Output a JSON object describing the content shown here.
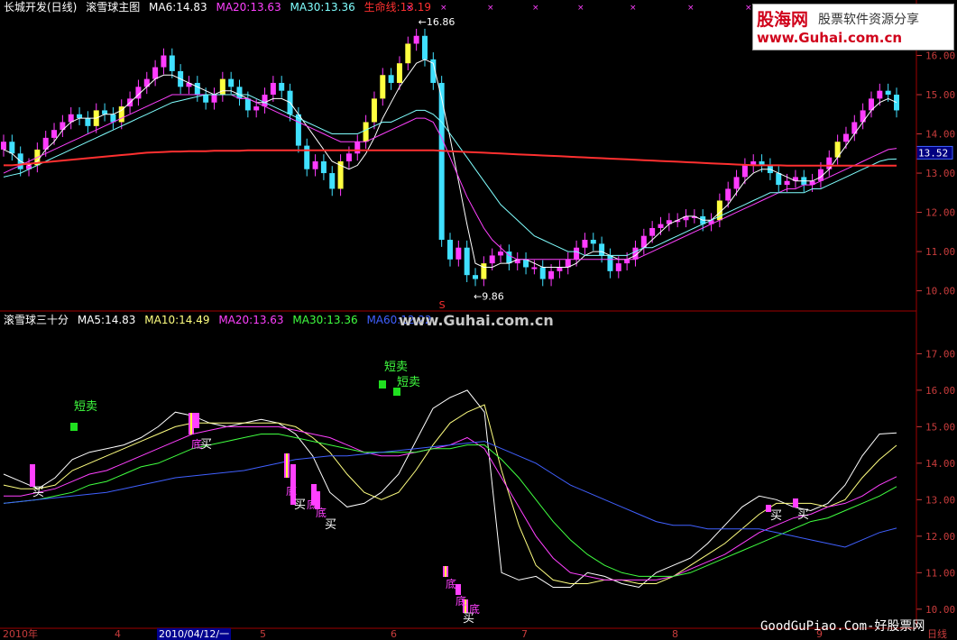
{
  "top_panel": {
    "labels": [
      {
        "text": "长城开发(日线)",
        "color": "#ffffff"
      },
      {
        "text": "滚雪球主图",
        "color": "#ffffff"
      },
      {
        "text": "MA6:14.83",
        "color": "#ffffff"
      },
      {
        "text": "MA20:13.63",
        "color": "#ff40ff"
      },
      {
        "text": "MA30:13.36",
        "color": "#80ffff"
      },
      {
        "text": "生命线:13.19",
        "color": "#ff3030"
      }
    ],
    "high_label": "16.86",
    "low_label": "9.86",
    "current_price": "13.52",
    "marker_s": "S"
  },
  "bottom_panel": {
    "labels": [
      {
        "text": "滚雪球三十分",
        "color": "#ffffff"
      },
      {
        "text": "MA5:14.83",
        "color": "#ffffff"
      },
      {
        "text": "MA10:14.49",
        "color": "#ffff80"
      },
      {
        "text": "MA20:13.63",
        "color": "#ff40ff"
      },
      {
        "text": "MA30:13.36",
        "color": "#40ff40"
      },
      {
        "text": "MA60:12.22",
        "color": "#4060ff"
      }
    ],
    "signals": {
      "short_sell": "短卖",
      "buy": "买",
      "bottom": "底"
    }
  },
  "logo": {
    "line1": "股海网",
    "line1b": "股票软件资源分享",
    "line2": "www.Guhai.com.cn"
  },
  "watermark": "www.Guhai.com.cn",
  "footer_mark": "GoodGuPiao.Com-好股票网",
  "x_axis": {
    "labels": [
      "2010年",
      "4",
      "2010/04/12/一",
      "5",
      "6",
      "7",
      "8",
      "9",
      "日线"
    ],
    "selected": "2010/04/12/一"
  },
  "chart_data": [
    {
      "type": "candlestick",
      "title": "长城开发(日线) 滚雪球主图",
      "ylim": [
        9.6,
        17.0
      ],
      "y_ticks": [
        10.0,
        11.0,
        12.0,
        13.0,
        14.0,
        15.0,
        16.0
      ],
      "close": [
        13.8,
        13.5,
        13.1,
        13.2,
        13.6,
        13.9,
        14.1,
        14.3,
        14.5,
        14.4,
        14.2,
        14.6,
        14.5,
        14.3,
        14.7,
        14.9,
        15.2,
        15.4,
        15.7,
        16.0,
        15.6,
        15.2,
        15.3,
        15.0,
        14.8,
        15.0,
        15.4,
        15.2,
        14.9,
        14.6,
        14.7,
        15.0,
        15.3,
        15.1,
        14.5,
        13.7,
        13.1,
        13.3,
        13.0,
        12.6,
        13.3,
        13.5,
        13.8,
        14.3,
        14.9,
        15.5,
        15.3,
        15.8,
        16.3,
        16.5,
        15.9,
        15.3,
        11.3,
        10.8,
        11.1,
        10.4,
        10.3,
        10.7,
        10.9,
        11.0,
        10.7,
        10.8,
        10.6,
        10.6,
        10.3,
        10.5,
        10.6,
        10.8,
        11.1,
        11.3,
        11.2,
        10.9,
        10.5,
        10.7,
        10.8,
        11.1,
        11.4,
        11.6,
        11.7,
        11.8,
        11.8,
        11.9,
        11.9,
        11.7,
        11.8,
        12.3,
        12.6,
        12.9,
        13.2,
        13.3,
        13.2,
        13.0,
        12.7,
        12.8,
        12.9,
        12.7,
        12.8,
        13.1,
        13.4,
        13.8,
        14.0,
        14.3,
        14.6,
        14.9,
        15.1,
        15.0,
        14.6
      ],
      "series": [
        {
          "name": "MA6",
          "values": [
            13.6,
            13.5,
            13.3,
            13.2,
            13.3,
            13.6,
            13.8,
            14.1,
            14.3,
            14.4,
            14.4,
            14.4,
            14.5,
            14.5,
            14.6,
            14.8,
            15.0,
            15.2,
            15.4,
            15.5,
            15.5,
            15.4,
            15.3,
            15.2,
            15.1,
            15.0,
            15.1,
            15.1,
            15.0,
            14.9,
            14.8,
            14.8,
            14.9,
            14.9,
            14.8,
            14.5,
            14.2,
            13.9,
            13.6,
            13.3,
            13.2,
            13.1,
            13.2,
            13.5,
            13.9,
            14.4,
            14.8,
            15.2,
            15.5,
            15.8,
            15.9,
            15.8,
            14.9,
            13.9,
            12.8,
            11.7,
            10.7,
            10.6,
            10.6,
            10.7,
            10.7,
            10.8,
            10.8,
            10.7,
            10.6,
            10.6,
            10.6,
            10.6,
            10.7,
            10.9,
            11.0,
            11.0,
            10.9,
            10.8,
            10.8,
            10.9,
            11.1,
            11.3,
            11.5,
            11.7,
            11.8,
            11.9,
            11.9,
            11.8,
            11.8,
            12.0,
            12.2,
            12.5,
            12.8,
            13.0,
            13.1,
            13.1,
            13.0,
            12.9,
            12.8,
            12.8,
            12.8,
            12.9,
            13.1,
            13.4,
            13.7,
            14.0,
            14.3,
            14.6,
            14.8,
            14.9,
            14.8
          ]
        },
        {
          "name": "MA20",
          "values": [
            13.0,
            13.1,
            13.2,
            13.3,
            13.4,
            13.5,
            13.6,
            13.7,
            13.8,
            13.9,
            14.0,
            14.1,
            14.2,
            14.3,
            14.4,
            14.5,
            14.6,
            14.7,
            14.8,
            14.9,
            15.0,
            15.0,
            15.0,
            15.0,
            15.0,
            15.0,
            15.0,
            15.0,
            14.9,
            14.9,
            14.8,
            14.7,
            14.6,
            14.5,
            14.4,
            14.3,
            14.2,
            14.1,
            14.0,
            13.9,
            13.8,
            13.8,
            13.8,
            13.8,
            13.9,
            14.0,
            14.1,
            14.2,
            14.3,
            14.4,
            14.4,
            14.3,
            13.9,
            13.4,
            12.9,
            12.4,
            12.0,
            11.6,
            11.3,
            11.1,
            10.9,
            10.8,
            10.8,
            10.8,
            10.8,
            10.8,
            10.8,
            10.8,
            10.8,
            10.8,
            10.8,
            10.8,
            10.8,
            10.8,
            10.8,
            10.8,
            10.9,
            11.0,
            11.1,
            11.2,
            11.3,
            11.4,
            11.5,
            11.6,
            11.7,
            11.8,
            11.9,
            12.0,
            12.1,
            12.2,
            12.3,
            12.4,
            12.5,
            12.6,
            12.6,
            12.7,
            12.7,
            12.8,
            12.9,
            13.0,
            13.1,
            13.2,
            13.3,
            13.4,
            13.5,
            13.6,
            13.63
          ]
        },
        {
          "name": "MA30",
          "values": [
            12.9,
            12.95,
            13.0,
            13.1,
            13.2,
            13.3,
            13.4,
            13.5,
            13.6,
            13.7,
            13.8,
            13.9,
            14.0,
            14.1,
            14.2,
            14.3,
            14.4,
            14.5,
            14.6,
            14.7,
            14.8,
            14.85,
            14.9,
            14.95,
            15.0,
            15.0,
            15.0,
            15.0,
            15.0,
            15.0,
            14.9,
            14.8,
            14.7,
            14.6,
            14.5,
            14.4,
            14.3,
            14.2,
            14.1,
            14.0,
            14.0,
            14.0,
            14.0,
            14.1,
            14.2,
            14.3,
            14.3,
            14.4,
            14.5,
            14.6,
            14.6,
            14.5,
            14.3,
            14.0,
            13.7,
            13.4,
            13.1,
            12.8,
            12.5,
            12.2,
            12.0,
            11.8,
            11.6,
            11.4,
            11.3,
            11.2,
            11.1,
            11.0,
            11.0,
            10.9,
            10.9,
            10.9,
            10.9,
            10.9,
            10.9,
            11.0,
            11.1,
            11.1,
            11.2,
            11.3,
            11.4,
            11.5,
            11.6,
            11.7,
            11.8,
            11.9,
            12.0,
            12.1,
            12.2,
            12.3,
            12.4,
            12.5,
            12.5,
            12.5,
            12.5,
            12.5,
            12.6,
            12.6,
            12.7,
            12.8,
            12.9,
            13.0,
            13.1,
            13.2,
            13.3,
            13.35,
            13.36
          ]
        },
        {
          "name": "生命线",
          "values": [
            13.2,
            13.2,
            13.22,
            13.24,
            13.26,
            13.28,
            13.3,
            13.32,
            13.34,
            13.36,
            13.38,
            13.4,
            13.42,
            13.44,
            13.46,
            13.48,
            13.5,
            13.52,
            13.53,
            13.54,
            13.55,
            13.55,
            13.56,
            13.56,
            13.56,
            13.57,
            13.57,
            13.57,
            13.57,
            13.58,
            13.58,
            13.58,
            13.58,
            13.58,
            13.58,
            13.58,
            13.58,
            13.58,
            13.58,
            13.58,
            13.58,
            13.58,
            13.58,
            13.58,
            13.58,
            13.58,
            13.58,
            13.58,
            13.58,
            13.58,
            13.58,
            13.58,
            13.57,
            13.56,
            13.55,
            13.54,
            13.53,
            13.52,
            13.51,
            13.5,
            13.49,
            13.48,
            13.47,
            13.46,
            13.45,
            13.44,
            13.43,
            13.42,
            13.41,
            13.4,
            13.39,
            13.38,
            13.37,
            13.36,
            13.35,
            13.34,
            13.33,
            13.32,
            13.31,
            13.3,
            13.29,
            13.28,
            13.27,
            13.26,
            13.25,
            13.24,
            13.23,
            13.22,
            13.21,
            13.2,
            13.2,
            13.2,
            13.2,
            13.19,
            13.19,
            13.19,
            13.19,
            13.19,
            13.19,
            13.19,
            13.19,
            13.19,
            13.19,
            13.19,
            13.19,
            13.19,
            13.19
          ]
        }
      ]
    },
    {
      "type": "line",
      "title": "滚雪球三十分",
      "ylim": [
        9.6,
        17.8
      ],
      "y_ticks": [
        10.0,
        11.0,
        12.0,
        13.0,
        14.0,
        15.0,
        16.0,
        17.0
      ],
      "series": [
        {
          "name": "MA5",
          "values": [
            13.7,
            13.5,
            13.3,
            13.6,
            14.1,
            14.3,
            14.4,
            14.5,
            14.7,
            15.0,
            15.4,
            15.3,
            15.1,
            15.0,
            15.1,
            15.2,
            15.1,
            14.8,
            14.2,
            13.2,
            12.8,
            12.9,
            13.2,
            13.7,
            14.6,
            15.5,
            15.8,
            16.0,
            15.4,
            11.0,
            10.8,
            10.9,
            10.6,
            10.6,
            11.0,
            10.9,
            10.7,
            10.6,
            11.0,
            11.2,
            11.4,
            11.8,
            12.3,
            12.8,
            13.1,
            13.0,
            12.8,
            12.7,
            12.9,
            13.4,
            14.2,
            14.8,
            14.83
          ]
        },
        {
          "name": "MA10",
          "values": [
            13.4,
            13.3,
            13.3,
            13.4,
            13.8,
            14.0,
            14.2,
            14.4,
            14.6,
            14.8,
            15.0,
            15.1,
            15.1,
            15.1,
            15.1,
            15.1,
            15.1,
            15.0,
            14.7,
            14.3,
            13.7,
            13.2,
            13.0,
            13.2,
            13.8,
            14.5,
            15.1,
            15.4,
            15.6,
            13.8,
            12.3,
            11.2,
            10.8,
            10.7,
            10.7,
            10.8,
            10.8,
            10.7,
            10.7,
            10.9,
            11.2,
            11.5,
            11.8,
            12.2,
            12.6,
            12.9,
            12.9,
            12.9,
            12.8,
            13.0,
            13.6,
            14.1,
            14.49
          ]
        },
        {
          "name": "MA20",
          "values": [
            13.1,
            13.1,
            13.2,
            13.3,
            13.5,
            13.7,
            13.8,
            14.0,
            14.2,
            14.4,
            14.6,
            14.8,
            14.9,
            15.0,
            15.0,
            15.0,
            15.0,
            14.9,
            14.8,
            14.7,
            14.5,
            14.3,
            14.2,
            14.2,
            14.3,
            14.4,
            14.5,
            14.7,
            14.4,
            13.6,
            12.8,
            12.0,
            11.4,
            11.0,
            10.9,
            10.8,
            10.8,
            10.8,
            10.8,
            10.9,
            11.1,
            11.3,
            11.5,
            11.8,
            12.1,
            12.3,
            12.5,
            12.6,
            12.8,
            12.9,
            13.1,
            13.4,
            13.63
          ]
        },
        {
          "name": "MA30",
          "values": [
            12.9,
            12.95,
            13.0,
            13.1,
            13.2,
            13.4,
            13.5,
            13.7,
            13.9,
            14.0,
            14.2,
            14.4,
            14.5,
            14.6,
            14.7,
            14.8,
            14.8,
            14.7,
            14.6,
            14.5,
            14.4,
            14.3,
            14.3,
            14.3,
            14.3,
            14.4,
            14.4,
            14.5,
            14.5,
            14.1,
            13.6,
            13.0,
            12.4,
            11.9,
            11.5,
            11.2,
            11.0,
            10.9,
            10.9,
            10.9,
            11.0,
            11.2,
            11.4,
            11.6,
            11.8,
            12.0,
            12.2,
            12.4,
            12.5,
            12.7,
            12.9,
            13.1,
            13.36
          ]
        },
        {
          "name": "MA60",
          "values": [
            12.9,
            12.95,
            13.0,
            13.05,
            13.1,
            13.15,
            13.2,
            13.3,
            13.4,
            13.5,
            13.6,
            13.65,
            13.7,
            13.75,
            13.8,
            13.9,
            14.0,
            14.1,
            14.15,
            14.2,
            14.2,
            14.25,
            14.3,
            14.35,
            14.4,
            14.45,
            14.5,
            14.55,
            14.6,
            14.4,
            14.2,
            14.0,
            13.7,
            13.4,
            13.2,
            13.0,
            12.8,
            12.6,
            12.4,
            12.3,
            12.3,
            12.2,
            12.2,
            12.2,
            12.2,
            12.1,
            12.0,
            11.9,
            11.8,
            11.7,
            11.9,
            12.1,
            12.22
          ]
        }
      ]
    }
  ]
}
